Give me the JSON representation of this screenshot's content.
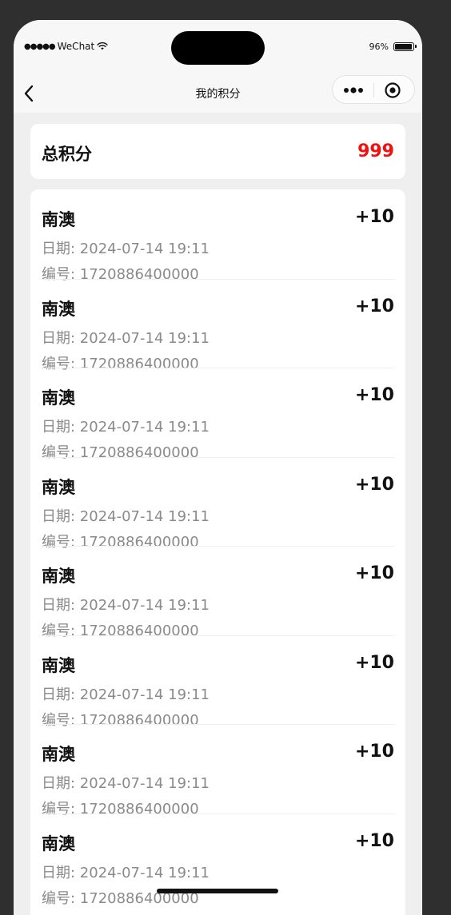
{
  "status_bar": {
    "carrier": "WeChat",
    "signal_dots": "●●●●●",
    "battery_percent": "96%",
    "battery_level": 0.96
  },
  "nav": {
    "title": "我的积分"
  },
  "total": {
    "label": "总积分",
    "value": "999",
    "value_color": "#f01010"
  },
  "records": [
    {
      "name": "南澳",
      "points": "+10",
      "date": "日期: 2024-07-14 19:11",
      "id": "编号: 1720886400000"
    },
    {
      "name": "南澳",
      "points": "+10",
      "date": "日期: 2024-07-14 19:11",
      "id": "编号: 1720886400000"
    },
    {
      "name": "南澳",
      "points": "+10",
      "date": "日期: 2024-07-14 19:11",
      "id": "编号: 1720886400000"
    },
    {
      "name": "南澳",
      "points": "+10",
      "date": "日期: 2024-07-14 19:11",
      "id": "编号: 1720886400000"
    },
    {
      "name": "南澳",
      "points": "+10",
      "date": "日期: 2024-07-14 19:11",
      "id": "编号: 1720886400000"
    },
    {
      "name": "南澳",
      "points": "+10",
      "date": "日期: 2024-07-14 19:11",
      "id": "编号: 1720886400000"
    },
    {
      "name": "南澳",
      "points": "+10",
      "date": "日期: 2024-07-14 19:11",
      "id": "编号: 1720886400000"
    },
    {
      "name": "南澳",
      "points": "+10",
      "date": "日期: 2024-07-14 19:11",
      "id": "编号: 1720886400000"
    }
  ]
}
